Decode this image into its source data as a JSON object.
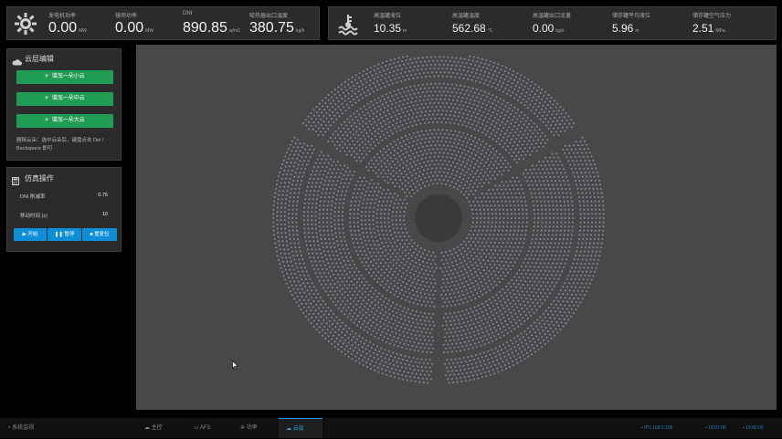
{
  "top_left": {
    "metrics": [
      {
        "label": "发电机功率",
        "value": "0.00",
        "unit": "MW"
      },
      {
        "label": "镜场功率",
        "value": "0.00",
        "unit": "MW"
      },
      {
        "label": "DNI",
        "value": "890.85",
        "unit": "w/m2"
      },
      {
        "label": "吸热器出口温度",
        "value": "380.75",
        "unit": "kg/h"
      }
    ]
  },
  "top_right": {
    "metrics": [
      {
        "label": "高温罐液位",
        "value": "10.35",
        "unit": "m"
      },
      {
        "label": "高温罐温度",
        "value": "562.68",
        "unit": "°C"
      },
      {
        "label": "高温罐出口流量",
        "value": "0.00",
        "unit": "kg/s"
      },
      {
        "label": "储存罐平均液位",
        "value": "5.96",
        "unit": "m"
      },
      {
        "label": "储存罐空气压力",
        "value": "2.51",
        "unit": "MPa"
      }
    ]
  },
  "cloud_edit": {
    "title": "云层编辑",
    "buttons": [
      "增加一朵小云",
      "增加一朵中云",
      "增加一朵大云"
    ],
    "hint": "删除云朵：选中云朵后，键盘点击 Del / Backspace 即可"
  },
  "sim": {
    "title": "仿真操作",
    "rows": [
      {
        "label": "DNI 削减率",
        "value": "0.75"
      },
      {
        "label": "移动时间 (s)",
        "value": "10"
      }
    ],
    "buttons": [
      "开始",
      "暂停",
      "重复位"
    ]
  },
  "nav": {
    "brand": "系统监视",
    "items": [
      "主控",
      "AF3",
      "功率",
      "云层"
    ],
    "active_index": 3
  },
  "status": {
    "ip": "IP1.168.0.109",
    "time1": "18:07:06",
    "time2": "15:00:00"
  },
  "colors": {
    "accent_blue": "#0c8fd6",
    "green_button": "#1f9d55",
    "panel": "#2b2b2b",
    "canvas": "#4a4a4a",
    "heliostat_dot": "#8a8aa0"
  }
}
